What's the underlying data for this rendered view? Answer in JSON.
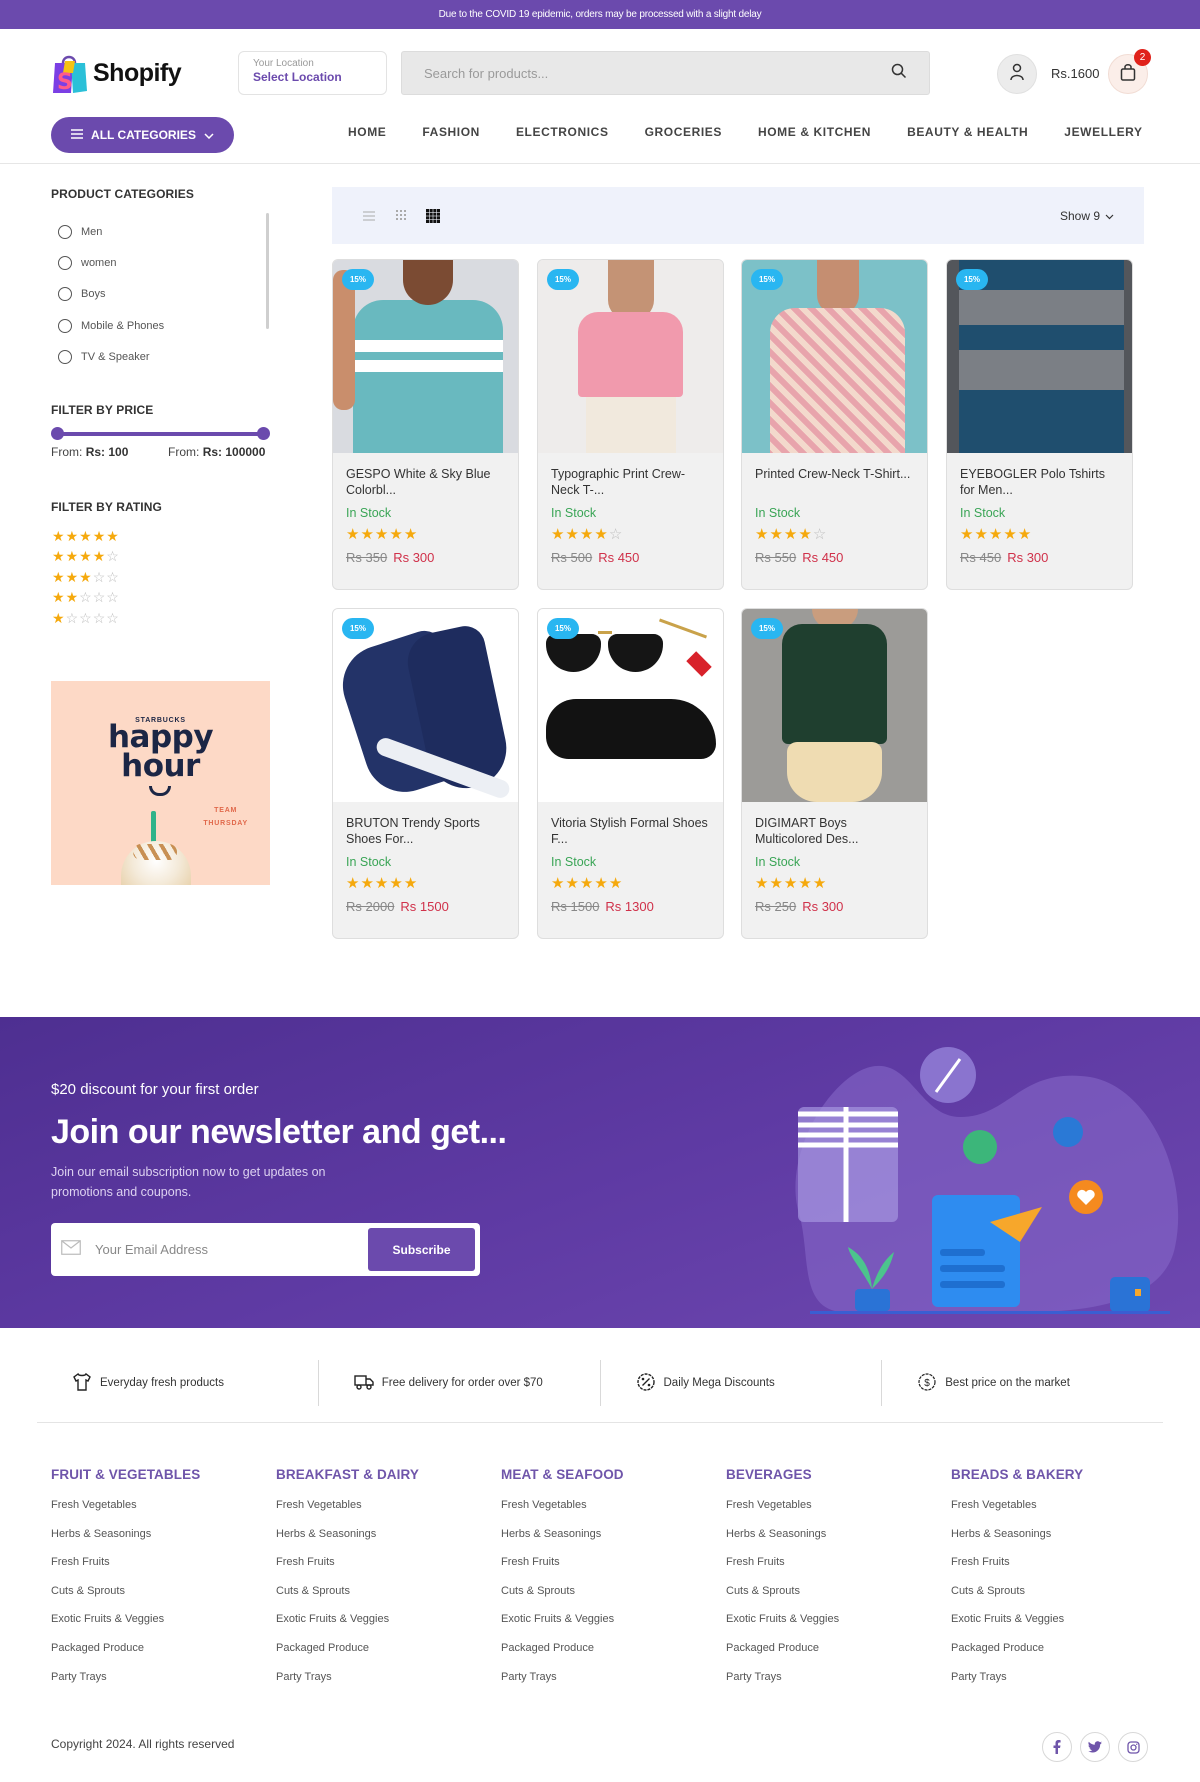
{
  "announcement": "Due to the COVID 19 epidemic, orders may be processed with a slight delay",
  "header": {
    "logo_text": "Shopify",
    "location": {
      "label": "Your Location",
      "value": "Select Location"
    },
    "search": {
      "placeholder": "Search for products...",
      "value": ""
    },
    "cart_total": "Rs.1600",
    "cart_count": "2"
  },
  "nav": {
    "all_categories_label": "ALL CATEGORIES",
    "items": [
      "HOME",
      "FASHION",
      "ELECTRONICS",
      "GROCERIES",
      "HOME & KITCHEN",
      "BEAUTY & HEALTH",
      "JEWELLERY"
    ]
  },
  "sidebar": {
    "categories_title": "PRODUCT CATEGORIES",
    "categories": [
      "Men",
      "women",
      "Boys",
      "Mobile & Phones",
      "TV & Speaker"
    ],
    "price_title": "FILTER BY PRICE",
    "price_from_prefix": "From:",
    "price_min": "Rs: 100",
    "price_max": "Rs: 100000",
    "price_range_fraction": [
      0,
      1
    ],
    "rating_title": "FILTER BY RATING",
    "rating_options": [
      5,
      4,
      3,
      2,
      1
    ],
    "promo": {
      "brand": "STARBUCKS",
      "title_line1": "happy",
      "title_line2": "hour",
      "tag_line1": "TEAM",
      "tag_line2": "THURSDAY"
    }
  },
  "toolbar": {
    "views": [
      "list-view",
      "grid-3-view",
      "grid-4-view"
    ],
    "active_view": "grid-4-view",
    "show_label": "Show 9"
  },
  "products": [
    {
      "name": "GESPO White & Sky Blue Colorbl...",
      "stock": "In Stock",
      "rating": 5,
      "old_price": "Rs 350",
      "price": "Rs 300",
      "discount": "15%",
      "image": "tshirt-teal"
    },
    {
      "name": "Typographic Print Crew-Neck T-...",
      "stock": "In Stock",
      "rating": 4,
      "old_price": "Rs 500",
      "price": "Rs 450",
      "discount": "15%",
      "image": "tshirt-pink"
    },
    {
      "name": "Printed Crew-Neck T-Shirt...",
      "stock": "In Stock",
      "rating": 4,
      "old_price": "Rs 550",
      "price": "Rs 450",
      "discount": "15%",
      "image": "kurti-pink"
    },
    {
      "name": "EYEBOGLER Polo Tshirts for Men...",
      "stock": "In Stock",
      "rating": 5,
      "old_price": "Rs 450",
      "price": "Rs 300",
      "discount": "15%",
      "image": "polo-navy"
    },
    {
      "name": "BRUTON Trendy Sports Shoes For...",
      "stock": "In Stock",
      "rating": 5,
      "old_price": "Rs 2000",
      "price": "Rs 1500",
      "discount": "15%",
      "image": "sneaker-navy"
    },
    {
      "name": "Vitoria Stylish Formal Shoes F...",
      "stock": "In Stock",
      "rating": 5,
      "old_price": "Rs 1500",
      "price": "Rs 1300",
      "discount": "15%",
      "image": "formal-shoe"
    },
    {
      "name": "DIGIMART Boys Multicolored Des...",
      "stock": "In Stock",
      "rating": 5,
      "old_price": "Rs 250",
      "price": "Rs 300",
      "discount": "15%",
      "image": "kurta-green"
    }
  ],
  "newsletter": {
    "subtitle": "$20 discount for your first order",
    "title": "Join our newsletter and get...",
    "description": "Join our email subscription now to get updates on promotions and coupons.",
    "email_placeholder": "Your Email Address",
    "email_value": "",
    "button_label": "Subscribe"
  },
  "features": [
    {
      "icon": "tshirt-icon",
      "label": "Everyday fresh products"
    },
    {
      "icon": "truck-icon",
      "label": "Free delivery for order over $70"
    },
    {
      "icon": "discount-badge-icon",
      "label": "Daily Mega Discounts"
    },
    {
      "icon": "dollar-badge-icon",
      "label": "Best price on the market"
    }
  ],
  "footer": {
    "columns": [
      {
        "title": "FRUIT & VEGETABLES",
        "links": [
          "Fresh Vegetables",
          "Herbs & Seasonings",
          "Fresh Fruits",
          "Cuts & Sprouts",
          "Exotic Fruits & Veggies",
          "Packaged Produce",
          "Party Trays"
        ]
      },
      {
        "title": "BREAKFAST & DAIRY",
        "links": [
          "Fresh Vegetables",
          "Herbs & Seasonings",
          "Fresh Fruits",
          "Cuts & Sprouts",
          "Exotic Fruits & Veggies",
          "Packaged Produce",
          "Party Trays"
        ]
      },
      {
        "title": "MEAT & SEAFOOD",
        "links": [
          "Fresh Vegetables",
          "Herbs & Seasonings",
          "Fresh Fruits",
          "Cuts & Sprouts",
          "Exotic Fruits & Veggies",
          "Packaged Produce",
          "Party Trays"
        ]
      },
      {
        "title": "BEVERAGES",
        "links": [
          "Fresh Vegetables",
          "Herbs & Seasonings",
          "Fresh Fruits",
          "Cuts & Sprouts",
          "Exotic Fruits & Veggies",
          "Packaged Produce",
          "Party Trays"
        ]
      },
      {
        "title": "BREADS & BAKERY",
        "links": [
          "Fresh Vegetables",
          "Herbs & Seasonings",
          "Fresh Fruits",
          "Cuts & Sprouts",
          "Exotic Fruits & Veggies",
          "Packaged Produce",
          "Party Trays"
        ]
      }
    ],
    "copyright": "Copyright 2024. All rights reserved",
    "social": [
      {
        "name": "facebook",
        "glyph": "f"
      },
      {
        "name": "twitter",
        "glyph": "t"
      },
      {
        "name": "instagram",
        "glyph": "i"
      }
    ]
  },
  "colors": {
    "brand": "#6b4aad",
    "in_stock": "#3aa556",
    "sale_price": "#d0314a",
    "discount_badge": "#29b6f1",
    "star": "#f5a90d",
    "cart_badge": "#e0221b"
  }
}
